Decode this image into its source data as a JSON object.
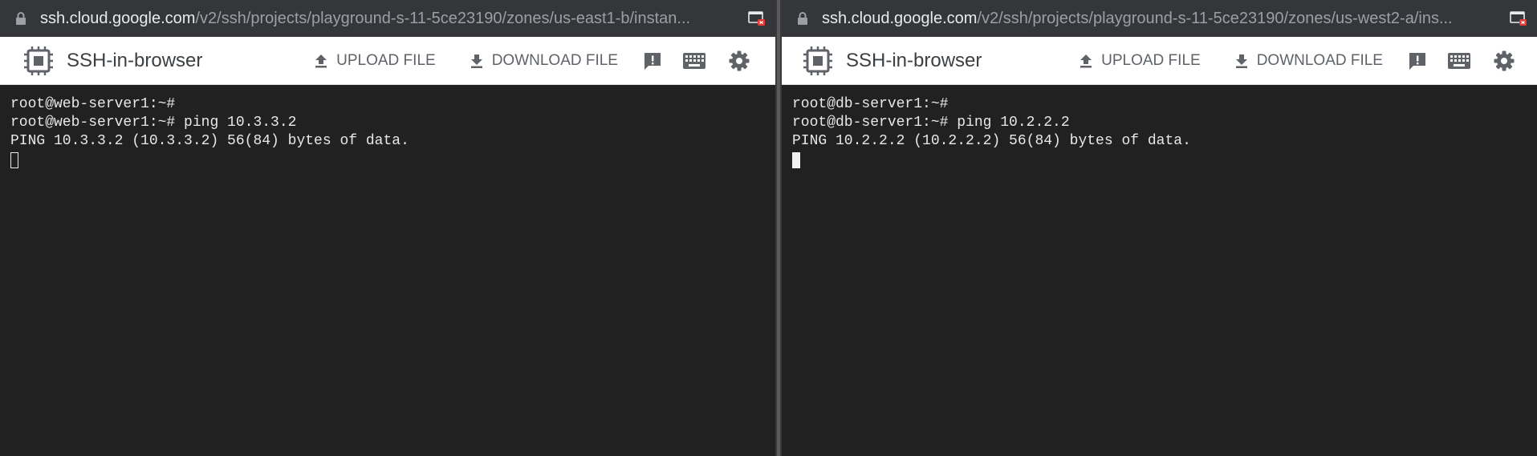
{
  "panes": [
    {
      "id": "left",
      "address": {
        "domain": "ssh.cloud.google.com",
        "path": "/v2/ssh/projects/playground-s-11-5ce23190/zones/us-east1-b/instan..."
      },
      "toolbar": {
        "title": "SSH-in-browser",
        "upload_label": "UPLOAD FILE",
        "download_label": "DOWNLOAD FILE"
      },
      "terminal": {
        "lines": [
          "root@web-server1:~#",
          "root@web-server1:~# ping 10.3.3.2",
          "PING 10.3.3.2 (10.3.3.2) 56(84) bytes of data."
        ],
        "cursor_style": "outline"
      }
    },
    {
      "id": "right",
      "address": {
        "domain": "ssh.cloud.google.com",
        "path": "/v2/ssh/projects/playground-s-11-5ce23190/zones/us-west2-a/ins..."
      },
      "toolbar": {
        "title": "SSH-in-browser",
        "upload_label": "UPLOAD FILE",
        "download_label": "DOWNLOAD FILE"
      },
      "terminal": {
        "lines": [
          "root@db-server1:~#",
          "root@db-server1:~# ping 10.2.2.2",
          "PING 10.2.2.2 (10.2.2.2) 56(84) bytes of data."
        ],
        "cursor_style": "solid"
      }
    }
  ],
  "icons": {
    "lock": "lock-icon",
    "chip": "compute-chip-icon",
    "upload": "upload-icon",
    "download": "download-icon",
    "feedback": "feedback-icon",
    "keyboard": "keyboard-icon",
    "settings": "gear-icon",
    "tab": "open-in-app-icon"
  },
  "colors": {
    "addressbar_bg": "#35363a",
    "terminal_bg": "#212121",
    "toolbar_bg": "#ffffff",
    "toolbar_icon": "#5f6368",
    "close_badge": "#e53935"
  }
}
